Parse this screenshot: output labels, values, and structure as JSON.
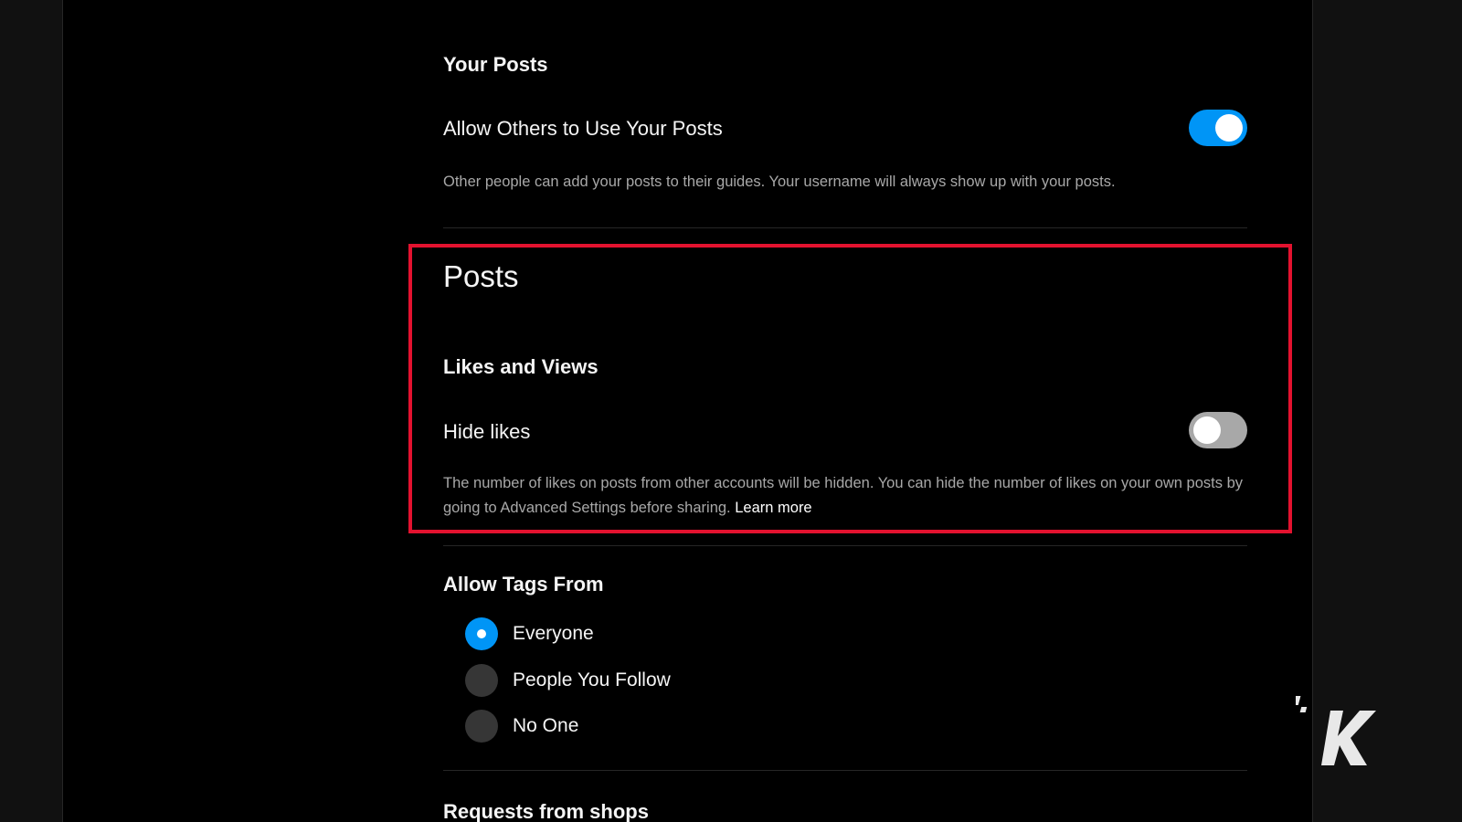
{
  "your_posts": {
    "heading": "Your Posts",
    "allow_others_label": "Allow Others to Use Your Posts",
    "allow_others_enabled": true,
    "allow_others_help": "Other people can add your posts to their guides. Your username will always show up with your posts."
  },
  "posts": {
    "title": "Posts",
    "likes_views_heading": "Likes and Views",
    "hide_likes_label": "Hide likes",
    "hide_likes_enabled": false,
    "hide_likes_help": "The number of likes on posts from other accounts will be hidden. You can hide the number of likes on your own posts by going to Advanced Settings before sharing.",
    "learn_more": "Learn more"
  },
  "tags": {
    "heading": "Allow Tags From",
    "options": [
      {
        "label": "Everyone",
        "selected": true
      },
      {
        "label": "People You Follow",
        "selected": false
      },
      {
        "label": "No One",
        "selected": false
      }
    ]
  },
  "shops": {
    "heading": "Requests from shops"
  },
  "colors": {
    "accent": "#0095f6",
    "highlight": "#e3122f",
    "background": "#000000"
  }
}
